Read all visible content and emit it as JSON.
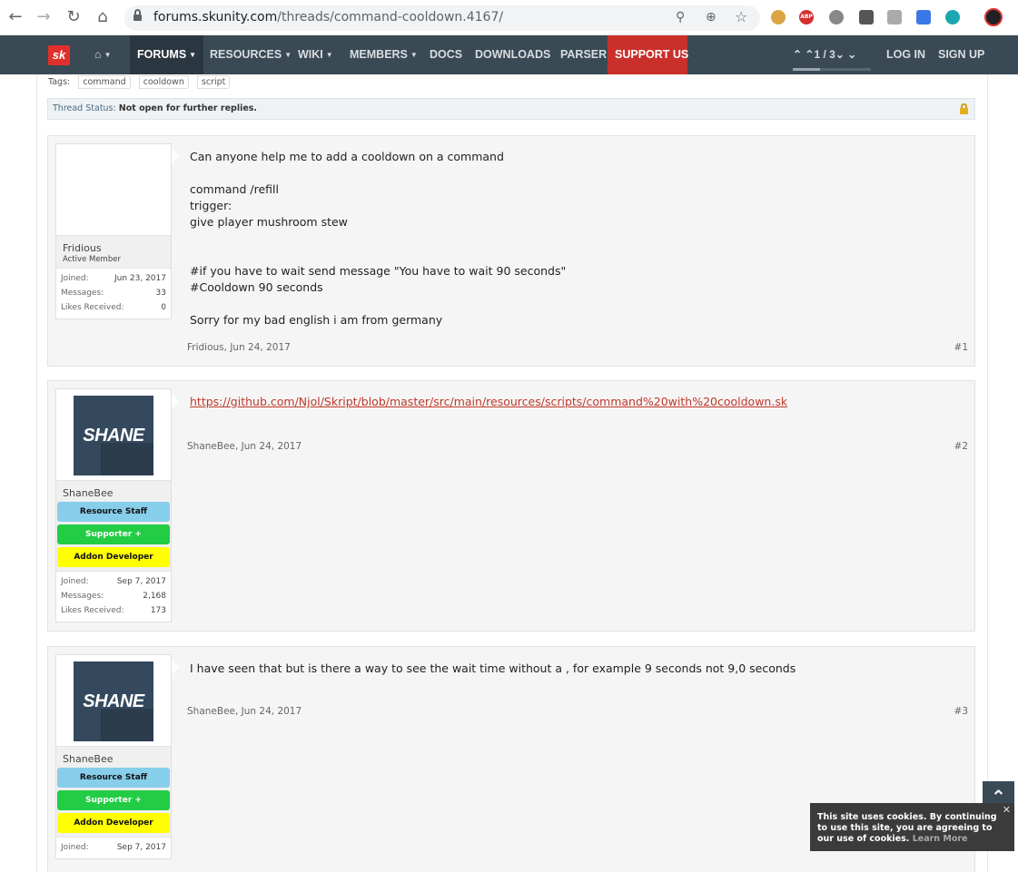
{
  "browser": {
    "url_host": "forums.skunity.com",
    "url_path": "/threads/command-cooldown.4167/"
  },
  "nav": {
    "logo": "sk",
    "items": [
      {
        "label": "FORUMS"
      },
      {
        "label": "RESOURCES"
      },
      {
        "label": "WIKI"
      },
      {
        "label": "MEMBERS"
      },
      {
        "label": "DOCS"
      },
      {
        "label": "DOWNLOADS"
      },
      {
        "label": "PARSER"
      },
      {
        "label": "SUPPORT US"
      }
    ],
    "pager": "1 / 3",
    "login": "LOG IN",
    "signup": "SIGN UP"
  },
  "thread": {
    "tags_label": "Tags:",
    "tags": [
      "command",
      "cooldown",
      "script"
    ],
    "status_label": "Thread Status:",
    "status_value": "Not open for further replies."
  },
  "posts": [
    {
      "username": "Fridious",
      "user_title": "Active Member",
      "joined_label": "Joined:",
      "joined": "Jun 23, 2017",
      "messages_label": "Messages:",
      "messages": "33",
      "likes_label": "Likes Received:",
      "likes": "0",
      "body": "Can anyone help me to add a cooldown on a command\n\ncommand /refill\ntrigger:\ngive player mushroom stew\n\n\n#if you have to wait send message \"You have to wait 90 seconds\"\n#Cooldown 90 seconds\n\nSorry for my bad english i am from germany",
      "meta": "Fridious, Jun 24, 2017",
      "number": "#1"
    },
    {
      "username": "ShaneBee",
      "avatar_text": "SHANE",
      "banners": [
        "Resource Staff",
        "Supporter +",
        "Addon Developer"
      ],
      "joined_label": "Joined:",
      "joined": "Sep 7, 2017",
      "messages_label": "Messages:",
      "messages": "2,168",
      "likes_label": "Likes Received:",
      "likes": "173",
      "link": "https://github.com/Njol/Skript/blob/master/src/main/resources/scripts/command%20with%20cooldown.sk",
      "meta": "ShaneBee, Jun 24, 2017",
      "number": "#2"
    },
    {
      "username": "ShaneBee",
      "avatar_text": "SHANE",
      "banners": [
        "Resource Staff",
        "Supporter +",
        "Addon Developer"
      ],
      "joined_label": "Joined:",
      "joined": "Sep 7, 2017",
      "body": "I have seen that but is there a way to see the wait time without a , for example 9 seconds not 9,0 seconds",
      "meta": "ShaneBee, Jun 24, 2017",
      "number": "#3"
    }
  ],
  "cookie": {
    "text": "This site uses cookies. By continuing to use this site, you are agreeing to our use of cookies.",
    "learn_more": "Learn More"
  },
  "colors": {
    "nav_bg": "#3a4a55",
    "support_bg": "#c9302c",
    "banner_staff": "#87ceeb",
    "banner_supporter": "#22cc44",
    "banner_addon": "#ffff00",
    "link": "#c0392b"
  },
  "icons": [
    "back-icon",
    "forward-icon",
    "reload-icon",
    "home-icon",
    "lock-icon",
    "key-icon",
    "zoom-icon",
    "star-icon",
    "scroll-top-icon",
    "close-icon"
  ]
}
